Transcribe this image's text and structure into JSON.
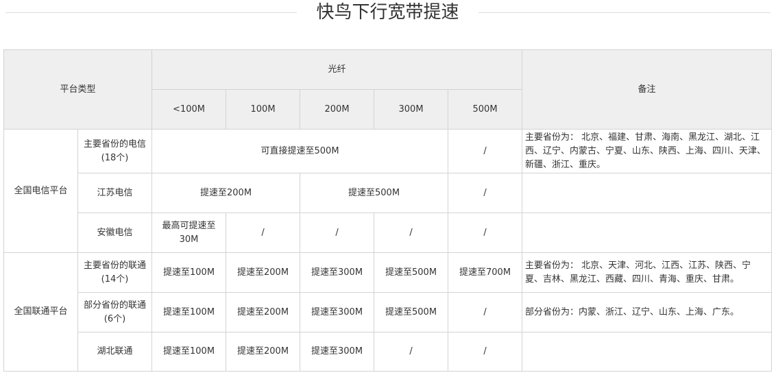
{
  "title": "快鸟下行宽带提速",
  "header": {
    "platform_type": "平台类型",
    "fiber": "光纤",
    "remark": "备注",
    "speeds": [
      "<100M",
      "100M",
      "200M",
      "300M",
      "500M"
    ]
  },
  "telecom": {
    "platform": "全国电信平台",
    "main_provinces": {
      "name": "主要省份的电信(18个)",
      "speed": "可直接提速至500M",
      "col500": "/",
      "note": "主要省份为： 北京、福建、甘肃、海南、黑龙江、湖北、江西、辽宁、内蒙古、宁夏、山东、陕西、上海、四川、天津、新疆、浙江、重庆。"
    },
    "jiangsu": {
      "name": "江苏电信",
      "speed_low": "提速至200M",
      "speed_high": "提速至500M",
      "col500": "/",
      "note": ""
    },
    "anhui": {
      "name": "安徽电信",
      "cells": [
        "最高可提速至30M",
        "/",
        "/",
        "/",
        "/"
      ],
      "note": ""
    }
  },
  "unicom": {
    "platform": "全国联通平台",
    "main_provinces": {
      "name": "主要省份的联通(14个)",
      "cells": [
        "提速至100M",
        "提速至200M",
        "提速至300M",
        "提速至500M",
        "提速至700M"
      ],
      "note": "主要省份为： 北京、天津、河北、江西、江苏、陕西、宁夏、吉林、黑龙江、西藏、四川、青海、重庆、甘肃。"
    },
    "some_provinces": {
      "name": "部分省份的联通(6个)",
      "cells": [
        "提速至100M",
        "提速至200M",
        "提速至300M",
        "提速至500M",
        "/"
      ],
      "note": "部分省份为：内蒙、浙江、辽宁、山东、上海、广东。"
    },
    "hubei": {
      "name": "湖北联通",
      "cells": [
        "提速至100M",
        "提速至200M",
        "提速至300M",
        "/",
        "/"
      ],
      "note": ""
    }
  },
  "colors": {
    "header_bg": "#efefef",
    "border": "#d3d3d3",
    "text": "#333333"
  }
}
